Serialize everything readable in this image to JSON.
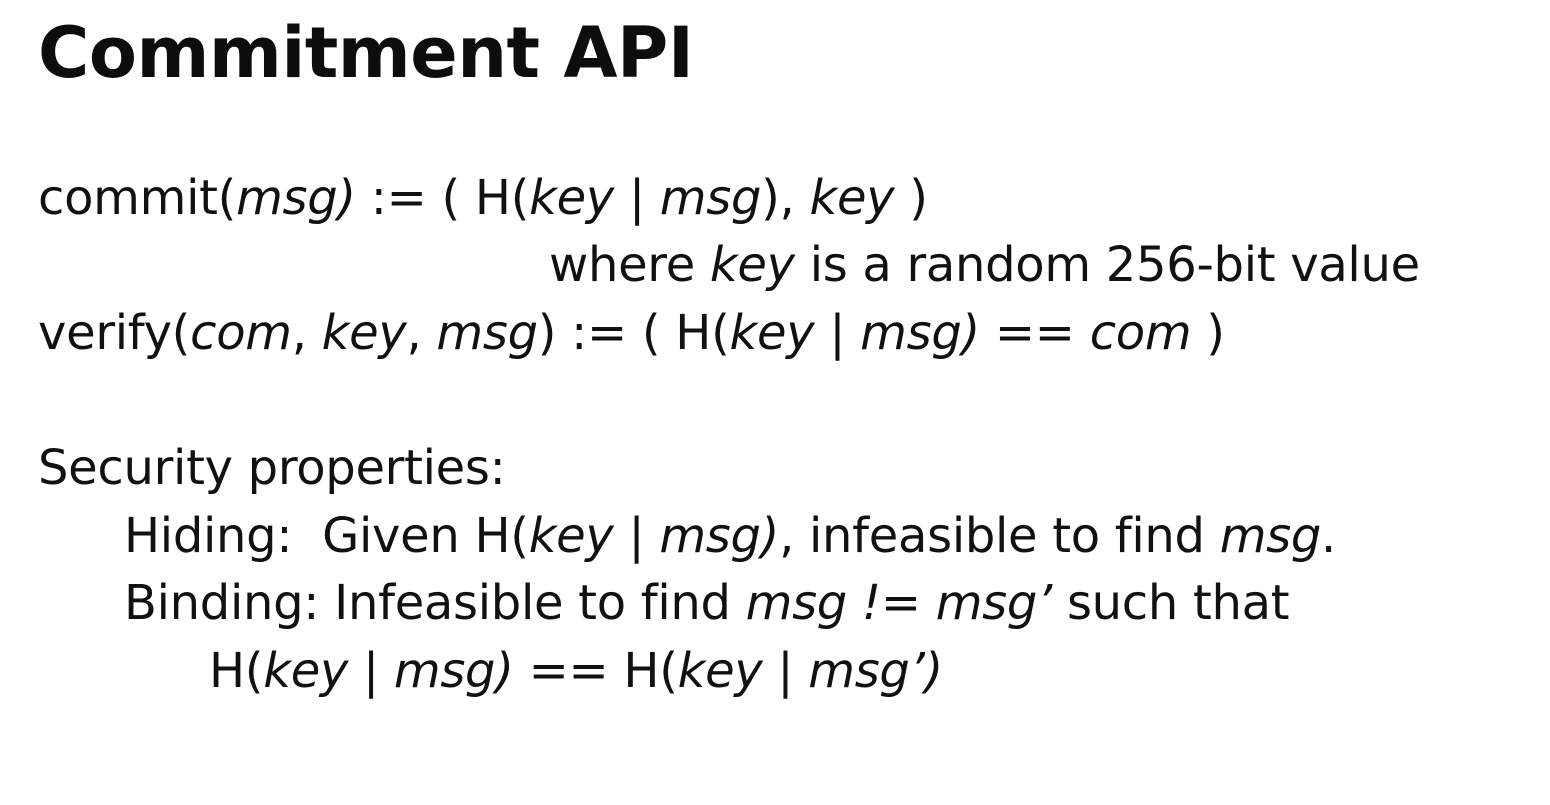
{
  "slide": {
    "title": "Commitment API",
    "lines": [
      {
        "id": "commit-definition",
        "segments": [
          {
            "text": "commit(",
            "italic": false
          },
          {
            "text": "msg)",
            "italic": true
          },
          {
            "text": " := ( H(",
            "italic": false
          },
          {
            "text": "key",
            "italic": true
          },
          {
            "text": " | ",
            "italic": false
          },
          {
            "text": "msg",
            "italic": true
          },
          {
            "text": "), ",
            "italic": false
          },
          {
            "text": "key",
            "italic": true
          },
          {
            "text": " )",
            "italic": false
          }
        ]
      },
      {
        "id": "key-note",
        "segments": [
          {
            "text": "where ",
            "italic": false
          },
          {
            "text": "key",
            "italic": true
          },
          {
            "text": " is a random 256-bit value",
            "italic": false
          }
        ]
      },
      {
        "id": "verify-definition",
        "segments": [
          {
            "text": "verify(",
            "italic": false
          },
          {
            "text": "com",
            "italic": true
          },
          {
            "text": ", ",
            "italic": false
          },
          {
            "text": "key",
            "italic": true
          },
          {
            "text": ", ",
            "italic": false
          },
          {
            "text": "msg",
            "italic": true
          },
          {
            "text": ") := ( H(",
            "italic": false
          },
          {
            "text": "key",
            "italic": true
          },
          {
            "text": " | ",
            "italic": false
          },
          {
            "text": "msg)",
            "italic": true
          },
          {
            "text": " == ",
            "italic": false
          },
          {
            "text": "com",
            "italic": true
          },
          {
            "text": " )",
            "italic": false
          }
        ]
      },
      {
        "id": "security-heading",
        "segments": [
          {
            "text": "Security properties:",
            "italic": false
          }
        ]
      },
      {
        "id": "hiding-property",
        "segments": [
          {
            "text": "Hiding:  Given H(",
            "italic": false
          },
          {
            "text": "key",
            "italic": true
          },
          {
            "text": " | ",
            "italic": false
          },
          {
            "text": "msg)",
            "italic": true
          },
          {
            "text": ", infeasible to find ",
            "italic": false
          },
          {
            "text": "msg",
            "italic": true
          },
          {
            "text": ".",
            "italic": false
          }
        ]
      },
      {
        "id": "binding-property",
        "segments": [
          {
            "text": "Binding: Infeasible to find ",
            "italic": false
          },
          {
            "text": "msg != msg’",
            "italic": true
          },
          {
            "text": " such that",
            "italic": false
          }
        ]
      },
      {
        "id": "binding-equation",
        "segments": [
          {
            "text": "H(",
            "italic": false
          },
          {
            "text": "key",
            "italic": true
          },
          {
            "text": " | ",
            "italic": false
          },
          {
            "text": "msg)",
            "italic": true
          },
          {
            "text": " == H(",
            "italic": false
          },
          {
            "text": "key",
            "italic": true
          },
          {
            "text": " | ",
            "italic": false
          },
          {
            "text": "msg’)",
            "italic": true
          }
        ]
      }
    ]
  }
}
